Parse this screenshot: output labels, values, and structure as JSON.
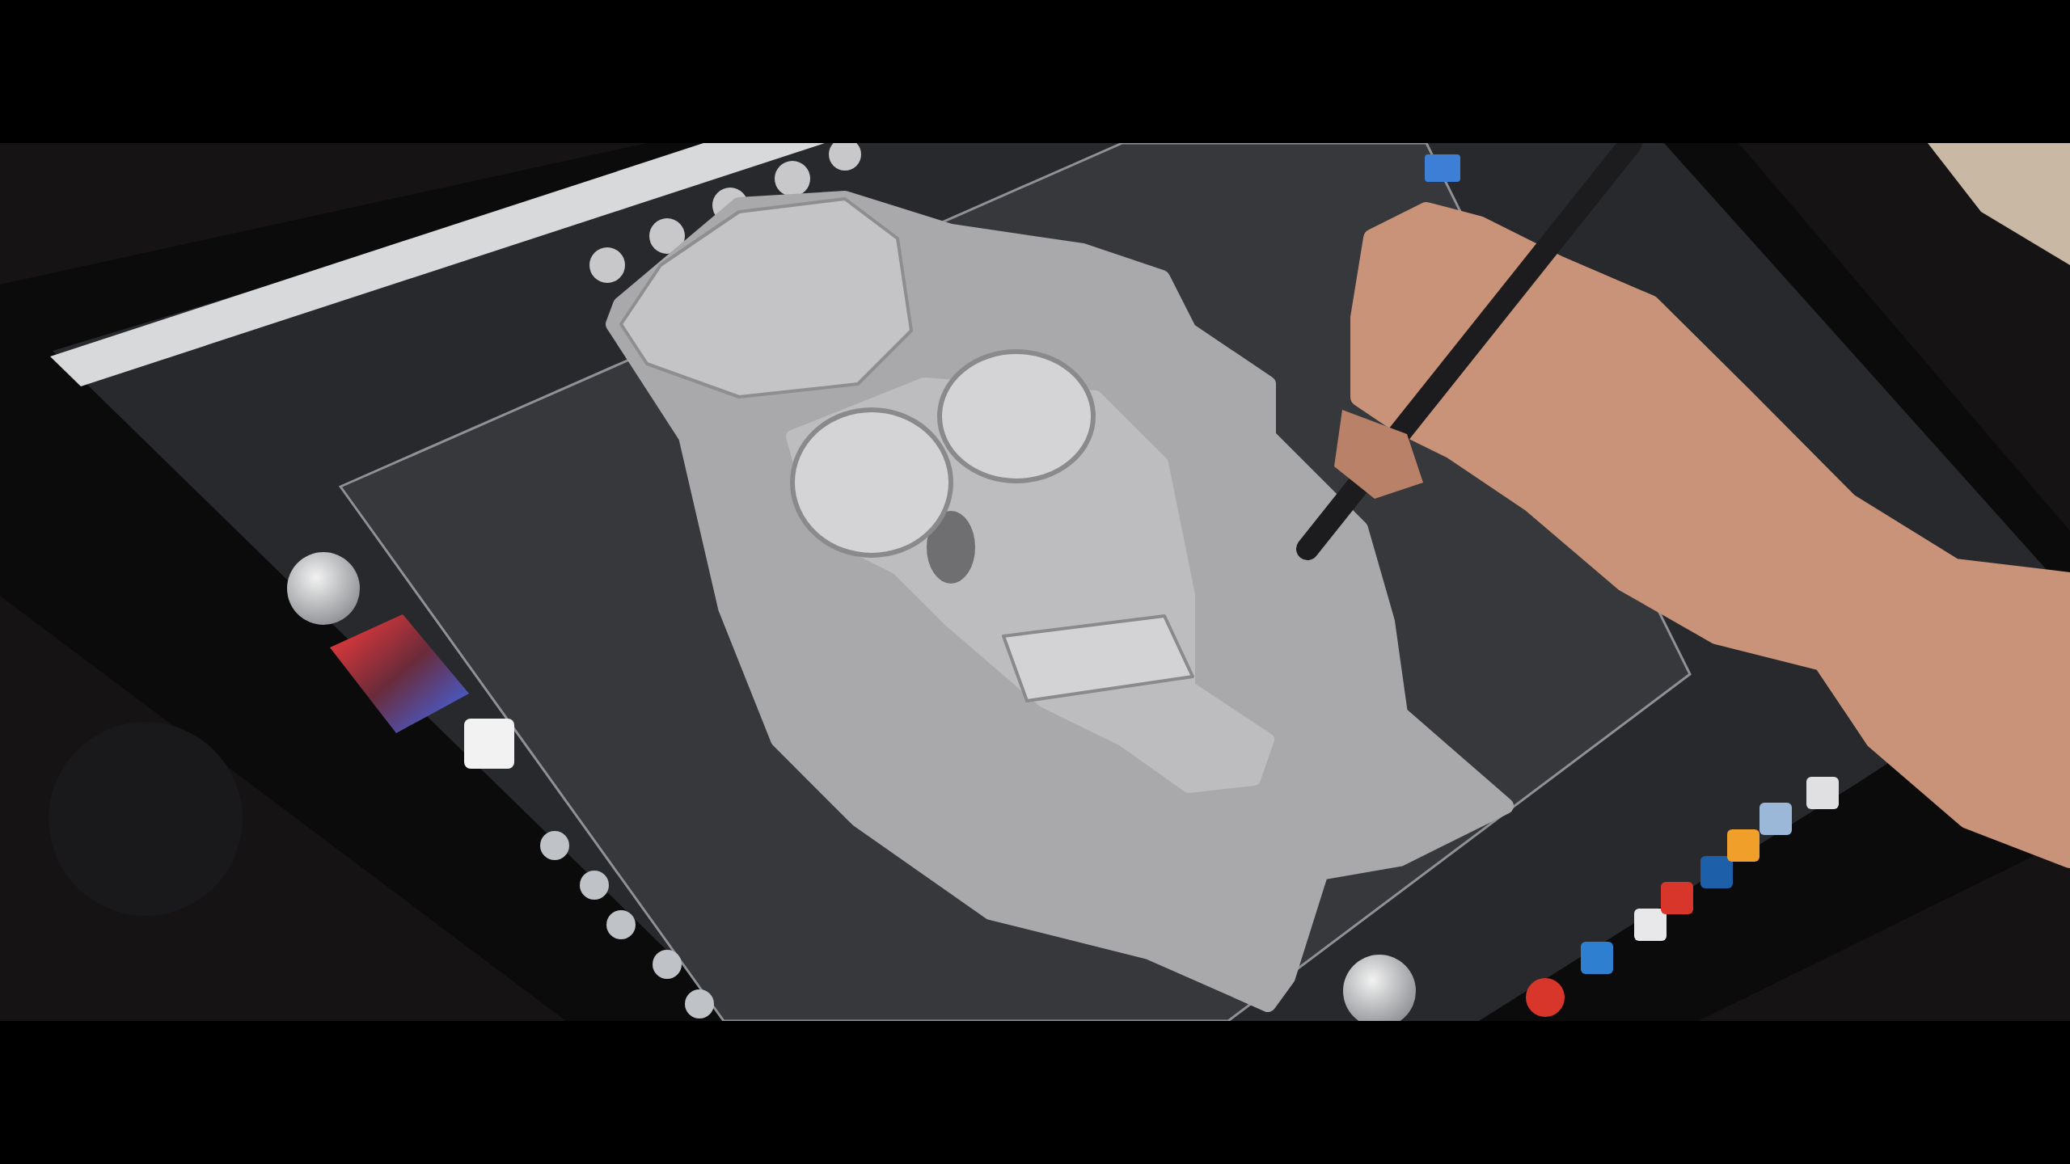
{
  "video_frame": {
    "letterboxed": true
  }
}
